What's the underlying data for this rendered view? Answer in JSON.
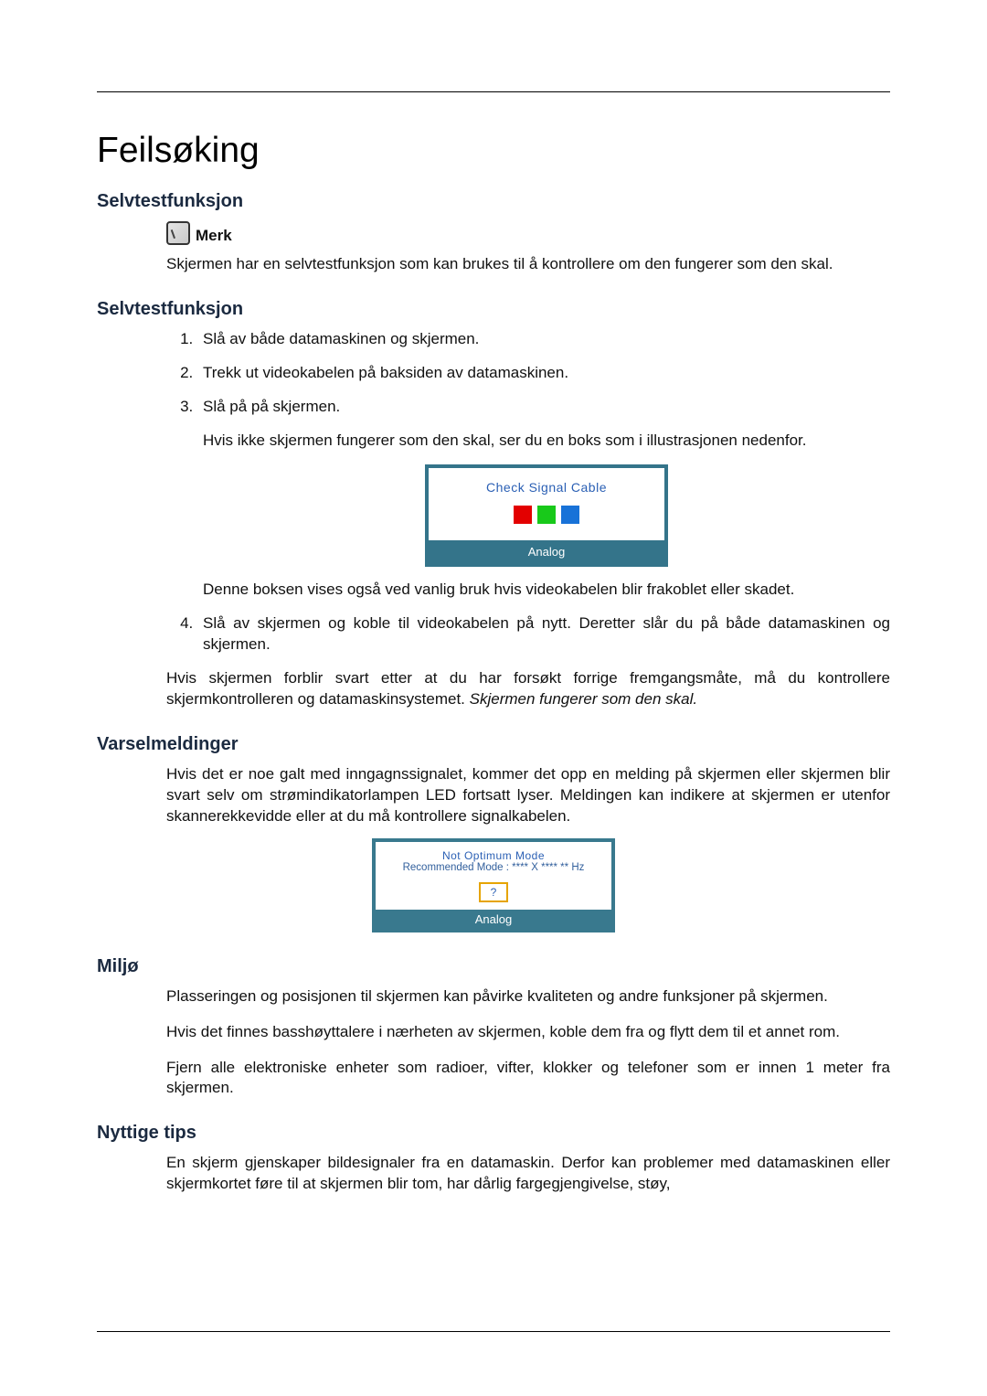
{
  "title": "Feilsøking",
  "sections": {
    "selftest1": {
      "heading": "Selvtestfunksjon",
      "note_label": "Merk",
      "note_text": "Skjermen har en selvtestfunksjon som kan brukes til å kontrollere om den fungerer som den skal."
    },
    "selftest2": {
      "heading": "Selvtestfunksjon",
      "steps": [
        "Slå av både datamaskinen og skjermen.",
        "Trekk ut videokabelen på baksiden av datamaskinen.",
        "Slå på på skjermen.",
        "Slå av skjermen og koble til videokabelen på nytt. Deretter slår du på både datamaskinen og skjermen."
      ],
      "step3_sub1": "Hvis ikke skjermen fungerer som den skal, ser du en boks som i illustrasjonen nedenfor.",
      "step3_sub2": "Denne boksen vises også ved vanlig bruk hvis videokabelen blir frakoblet eller skadet.",
      "closing_text": "Hvis skjermen forblir svart etter at du har forsøkt forrige fremgangsmåte, må du kontrollere skjermkontrolleren og datamaskinsystemet. ",
      "closing_italic": "Skjermen fungerer som den skal.",
      "osd1": {
        "title": "Check Signal Cable",
        "bar": "Analog"
      }
    },
    "varsel": {
      "heading": "Varselmeldinger",
      "text": "Hvis det er noe galt med inngagnssignalet, kommer det opp en melding på skjermen eller skjermen blir svart selv om strømindikatorlampen LED fortsatt lyser. Meldingen kan indikere at skjermen er utenfor skannerekkevidde eller at du må kontrollere signalkabelen.",
      "osd2": {
        "line1": "Not Optimum Mode",
        "line2": "Recommended Mode : **** X **** ** Hz",
        "q": "?",
        "bar": "Analog"
      }
    },
    "miljo": {
      "heading": "Miljø",
      "p1": "Plasseringen og posisjonen til skjermen kan påvirke kvaliteten og andre funksjoner på skjermen.",
      "p2": "Hvis det finnes basshøyttalere i nærheten av skjermen, koble dem fra og flytt dem til et annet rom.",
      "p3": "Fjern alle elektroniske enheter som radioer, vifter, klokker og telefoner som er innen 1 meter fra skjermen."
    },
    "tips": {
      "heading": "Nyttige tips",
      "p1": "En skjerm gjenskaper bildesignaler fra en datamaskin. Derfor kan problemer med datamaskinen eller skjermkortet føre til at skjermen blir tom, har dårlig fargegjengivelse, støy,"
    }
  }
}
